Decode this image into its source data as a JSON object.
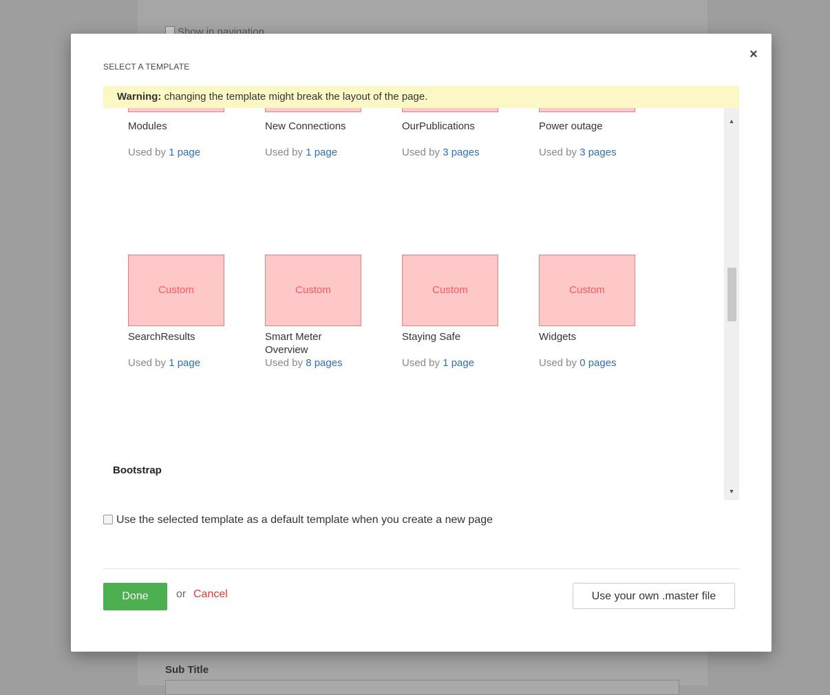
{
  "background": {
    "nav_label": "Show in navigation",
    "subtitle_label": "Sub Title"
  },
  "dialog": {
    "title": "SELECT A TEMPLATE",
    "close_icon": "×",
    "warning": {
      "strong": "Warning:",
      "text": " changing the template might break the layout of the page."
    },
    "templates_row1": [
      {
        "name": "Modules",
        "used_prefix": "Used by",
        "used_link": "1 page"
      },
      {
        "name": "New Connections",
        "used_prefix": "Used by",
        "used_link": "1 page"
      },
      {
        "name": "OurPublications",
        "used_prefix": "Used by",
        "used_link": "3 pages"
      },
      {
        "name": "Power outage",
        "used_prefix": "Used by",
        "used_link": "3 pages"
      }
    ],
    "templates_row2": [
      {
        "thumb": "Custom",
        "name": "SearchResults",
        "used_prefix": "Used by",
        "used_link": "1 page"
      },
      {
        "thumb": "Custom",
        "name": "Smart Meter Overview",
        "used_prefix": "Used by",
        "used_link": "8 pages"
      },
      {
        "thumb": "Custom",
        "name": "Staying Safe",
        "used_prefix": "Used by",
        "used_link": "1 page"
      },
      {
        "thumb": "Custom",
        "name": "Widgets",
        "used_prefix": "Used by",
        "used_link": "0 pages"
      }
    ],
    "group_label": "Bootstrap",
    "default_checkbox_label": "Use the selected template as a default template when you create a new page",
    "done_label": "Done",
    "or_text": "or",
    "cancel_label": "Cancel",
    "master_label": "Use your own .master file",
    "scroll_up_icon": "▲",
    "scroll_down_icon": "▼"
  },
  "colors": {
    "accent_green": "#4cb050",
    "link_blue": "#2e6fb6",
    "cancel_red": "#e53935",
    "thumb_fill": "#ffc8c8",
    "warning_bg": "#fcf8c6"
  }
}
